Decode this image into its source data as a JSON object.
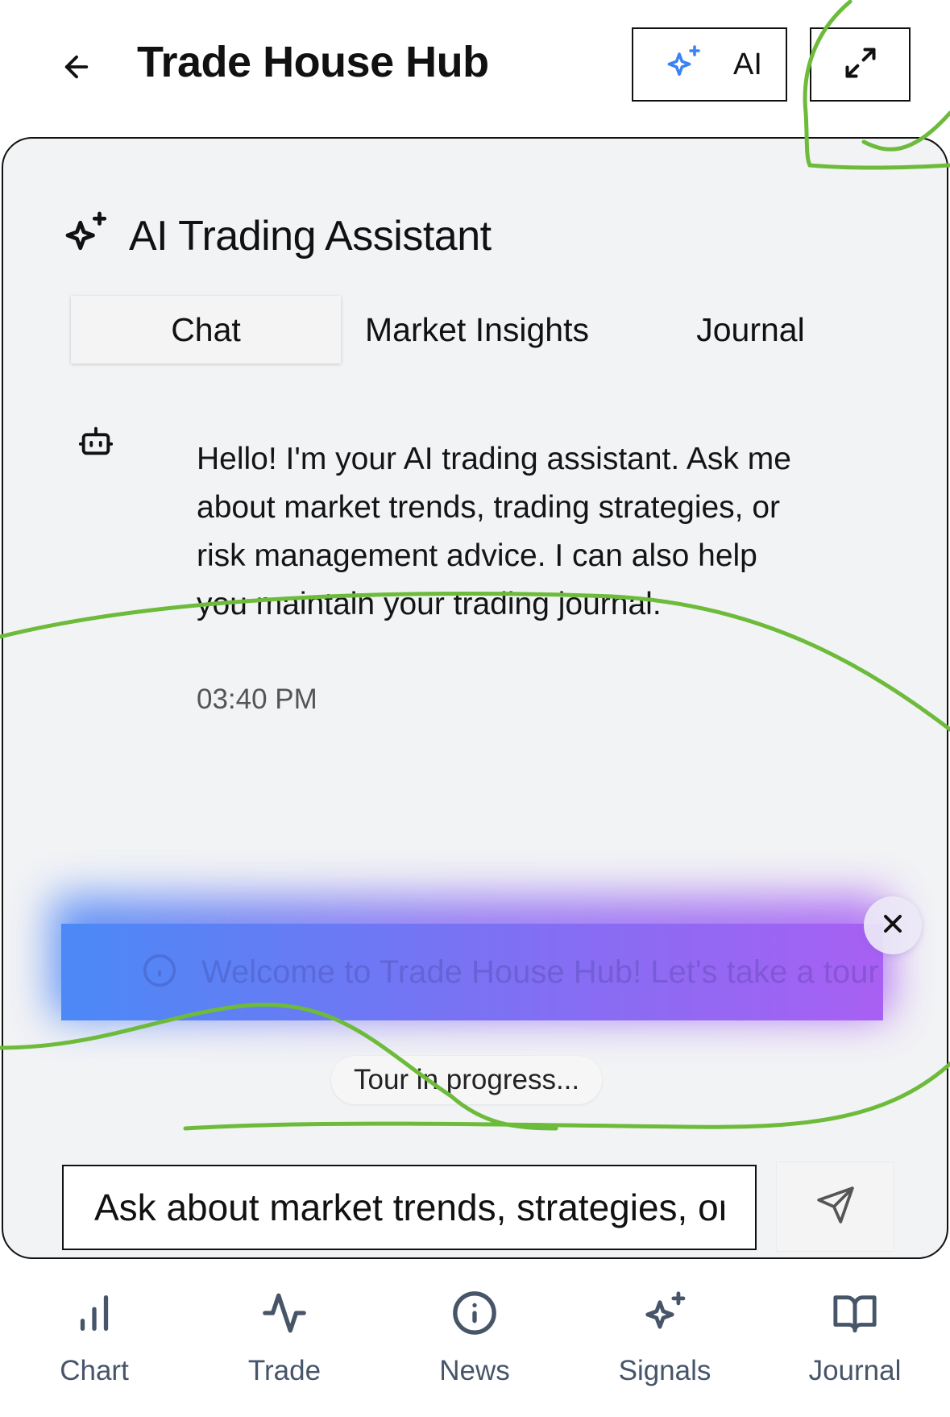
{
  "header": {
    "title": "Trade House Hub",
    "back_icon": "arrow-left-icon",
    "ai_button_label": "AI",
    "ai_icon": "sparkles-icon",
    "expand_icon": "maximize-icon"
  },
  "assistant": {
    "title": "AI Trading Assistant",
    "title_icon": "sparkles-icon",
    "tabs": [
      {
        "label": "Chat",
        "active": true
      },
      {
        "label": "Market Insights",
        "active": false
      },
      {
        "label": "Journal",
        "active": false
      }
    ],
    "messages": [
      {
        "sender_icon": "bot-icon",
        "text": "Hello! I'm your AI trading assistant. Ask me about market trends, trading strategies, or risk management advice. I can also help you maintain your trading journal.",
        "time": "03:40 PM"
      }
    ],
    "tour": {
      "banner_text": "Welcome to Trade House Hub! Let's take a tour",
      "close_icon": "close-icon",
      "status": "Tour in progress..."
    },
    "input": {
      "placeholder": "Ask about market trends, strategies, or risk management...",
      "value": ""
    },
    "send_icon": "send-icon"
  },
  "bottom_nav": [
    {
      "label": "Chart",
      "icon": "bar-chart-icon"
    },
    {
      "label": "Trade",
      "icon": "activity-icon"
    },
    {
      "label": "News",
      "icon": "info-icon"
    },
    {
      "label": "Signals",
      "icon": "sparkles-icon"
    },
    {
      "label": "Journal",
      "icon": "book-open-icon"
    }
  ],
  "colors": {
    "accent_blue": "#3b82f6",
    "panel_bg": "#f2f3f5",
    "tour_gradient_start": "#4b89f6",
    "tour_gradient_end": "#a860f3",
    "annotation_stroke": "#6dbb3a"
  }
}
